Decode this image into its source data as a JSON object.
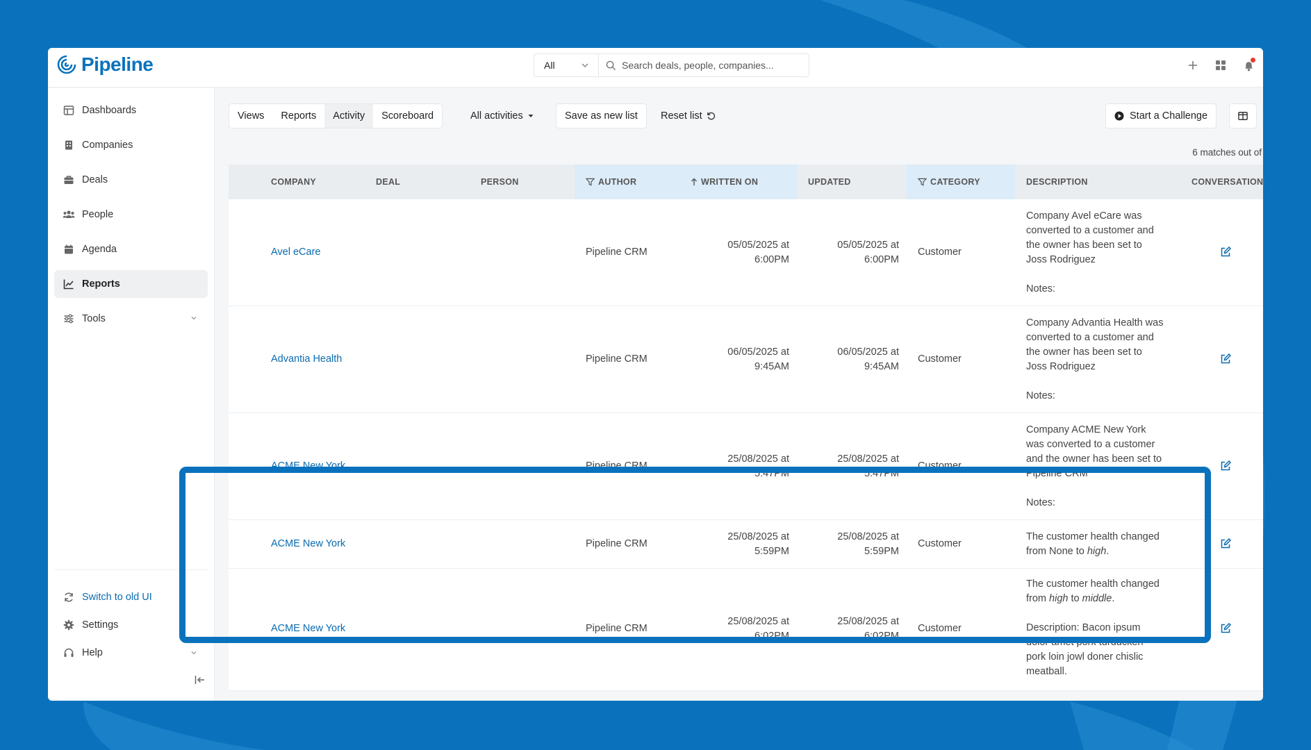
{
  "topbar": {
    "brand": "Pipeline",
    "scope_value": "All",
    "search_placeholder": "Search deals, people, companies..."
  },
  "sidebar": {
    "items": [
      {
        "label": "Dashboards",
        "icon": "dashboard-icon"
      },
      {
        "label": "Companies",
        "icon": "building-icon"
      },
      {
        "label": "Deals",
        "icon": "briefcase-icon"
      },
      {
        "label": "People",
        "icon": "people-icon"
      },
      {
        "label": "Agenda",
        "icon": "calendar-icon"
      },
      {
        "label": "Reports",
        "icon": "chart-line-icon",
        "active": true
      },
      {
        "label": "Tools",
        "icon": "sliders-icon"
      }
    ],
    "bottom": {
      "switch_ui": "Switch to old UI",
      "settings": "Settings",
      "help": "Help"
    }
  },
  "toolbar": {
    "tabs": [
      "Views",
      "Reports",
      "Activity",
      "Scoreboard"
    ],
    "active_tab": "Activity",
    "filter": "All activities",
    "save_list": "Save as new list",
    "reset_list": "Reset list",
    "challenge": "Start a Challenge"
  },
  "matches": "6 matches out of",
  "table": {
    "columns": [
      "COMPANY",
      "DEAL",
      "PERSON",
      "AUTHOR",
      "WRITTEN ON",
      "UPDATED",
      "CATEGORY",
      "DESCRIPTION",
      "CONVERSATION"
    ],
    "rows": [
      {
        "company": "Avel eCare",
        "author": "Pipeline CRM",
        "written_1": "05/05/2025 at",
        "written_2": "6:00PM",
        "updated_1": "05/05/2025 at",
        "updated_2": "6:00PM",
        "category": "Customer",
        "desc_1": "Company Avel eCare was",
        "desc_2": "converted to a customer and",
        "desc_3": "the owner has been set to",
        "desc_4": "Joss Rodriguez",
        "desc_5": "Notes:"
      },
      {
        "company": "Advantia Health",
        "author": "Pipeline CRM",
        "written_1": "06/05/2025 at",
        "written_2": "9:45AM",
        "updated_1": "06/05/2025 at",
        "updated_2": "9:45AM",
        "category": "Customer",
        "desc_1": "Company Advantia Health was",
        "desc_2": "converted to a customer and",
        "desc_3": "the owner has been set to",
        "desc_4": "Joss Rodriguez",
        "desc_5": "Notes:"
      },
      {
        "company": "ACME New York",
        "author": "Pipeline CRM",
        "written_1": "25/08/2025 at",
        "written_2": "5:47PM",
        "updated_1": "25/08/2025 at",
        "updated_2": "5:47PM",
        "category": "Customer",
        "desc_1": "Company ACME New York",
        "desc_2": "was converted to a customer",
        "desc_3": "and the owner has been set to",
        "desc_4": "Pipeline CRM",
        "desc_5": "Notes:"
      },
      {
        "company": "ACME New York",
        "author": "Pipeline CRM",
        "written_1": "25/08/2025 at",
        "written_2": "5:59PM",
        "updated_1": "25/08/2025 at",
        "updated_2": "5:59PM",
        "category": "Customer",
        "desc_1": "The customer health changed",
        "desc_2a": "from None to ",
        "desc_2b": "high",
        "desc_2c": "."
      },
      {
        "company": "ACME New York",
        "author": "Pipeline CRM",
        "written_1": "25/08/2025 at",
        "written_2": "6:02PM",
        "updated_1": "25/08/2025 at",
        "updated_2": "6:02PM",
        "category": "Customer",
        "desc_1": "The customer health changed",
        "desc_2a": "from ",
        "desc_2b": "high",
        "desc_2c": " to ",
        "desc_2d": "middle",
        "desc_2e": ".",
        "desc_3": "Description: Bacon ipsum",
        "desc_4": "dolor amet pork turducken",
        "desc_5": "pork loin jowl doner chislic",
        "desc_6": "meatball."
      }
    ]
  },
  "colors": {
    "brand": "#0a72bd",
    "link": "#0a6bb0",
    "header_highlight": "#dcecf8",
    "notification": "#e53935"
  }
}
